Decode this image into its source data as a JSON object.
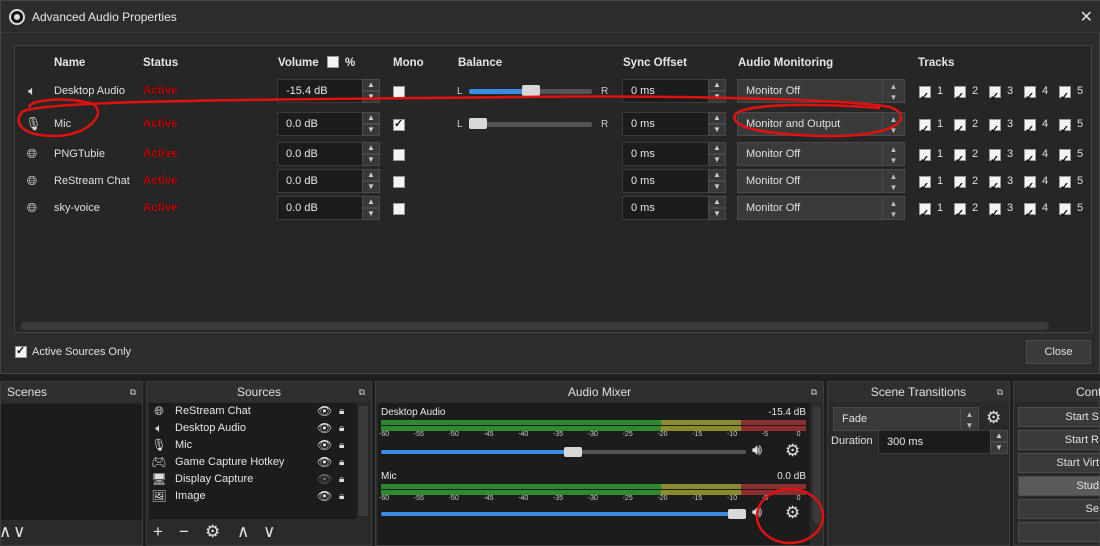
{
  "window": {
    "title": "Advanced Audio Properties",
    "close_glyph": "✕"
  },
  "columns": {
    "name": "Name",
    "status": "Status",
    "volume": "Volume",
    "percent": "%",
    "mono": "Mono",
    "balance": "Balance",
    "sync_offset": "Sync Offset",
    "audio_monitoring": "Audio Monitoring",
    "tracks": "Tracks"
  },
  "balance_labels": {
    "left": "L",
    "right": "R"
  },
  "rows": [
    {
      "icon": "speaker-icon",
      "name": "Desktop Audio",
      "status": "Active",
      "volume": "-15.4 dB",
      "mono": false,
      "balance": 0.5,
      "show_balance": true,
      "sync": "0 ms",
      "monitoring": "Monitor Off",
      "tracks": [
        true,
        true,
        true,
        true,
        true
      ]
    },
    {
      "icon": "microphone-icon",
      "name": "Mic",
      "status": "Active",
      "volume": "0.0 dB",
      "mono": true,
      "balance": 0.0,
      "show_balance": true,
      "sync": "0 ms",
      "monitoring": "Monitor and Output",
      "tracks": [
        true,
        true,
        true,
        true,
        true
      ]
    },
    {
      "icon": "globe-icon",
      "name": "PNGTubie",
      "status": "Active",
      "volume": "0.0 dB",
      "mono": false,
      "show_balance": false,
      "sync": "0 ms",
      "monitoring": "Monitor Off",
      "tracks": [
        true,
        true,
        true,
        true,
        true
      ]
    },
    {
      "icon": "globe-icon",
      "name": "ReStream Chat",
      "status": "Active",
      "volume": "0.0 dB",
      "mono": false,
      "show_balance": false,
      "sync": "0 ms",
      "monitoring": "Monitor Off",
      "tracks": [
        true,
        true,
        true,
        true,
        true
      ]
    },
    {
      "icon": "globe-icon",
      "name": "sky-voice",
      "status": "Active",
      "volume": "0.0 dB",
      "mono": false,
      "show_balance": false,
      "sync": "0 ms",
      "monitoring": "Monitor Off",
      "tracks": [
        true,
        true,
        true,
        true,
        true
      ]
    }
  ],
  "track_numbers": [
    "1",
    "2",
    "3",
    "4",
    "5"
  ],
  "footer": {
    "active_only_label": "Active Sources Only",
    "active_only_checked": true,
    "close_button": "Close"
  },
  "docks": {
    "scenes": {
      "title": "Scenes"
    },
    "sources": {
      "title": "Sources",
      "items": [
        {
          "icon": "globe-icon",
          "label": "ReStream Chat",
          "visible": true
        },
        {
          "icon": "speaker-icon",
          "label": "Desktop Audio",
          "visible": true
        },
        {
          "icon": "microphone-icon",
          "label": "Mic",
          "visible": true
        },
        {
          "icon": "gamepad-icon",
          "label": "Game Capture Hotkey",
          "visible": true
        },
        {
          "icon": "monitor-icon",
          "label": "Display Capture",
          "visible": false
        },
        {
          "icon": "image-icon",
          "label": "Image",
          "visible": true
        }
      ]
    },
    "mixer": {
      "title": "Audio Mixer",
      "scale_ticks": [
        "-60",
        "-55",
        "-50",
        "-45",
        "-40",
        "-35",
        "-30",
        "-25",
        "-20",
        "-15",
        "-10",
        "-5",
        "0"
      ],
      "channels": [
        {
          "name": "Desktop Audio",
          "db": "-15.4 dB",
          "volume_level": 0.55
        },
        {
          "name": "Mic",
          "db": "0.0 dB",
          "volume_level": 1.0
        }
      ]
    },
    "transitions": {
      "title": "Scene Transitions",
      "selected": "Fade",
      "duration_label": "Duration",
      "duration_value": "300 ms"
    },
    "controls": {
      "title": "Cont",
      "buttons": [
        "Start S",
        "Start R",
        "Start Virt",
        "Stud",
        "Se",
        ""
      ]
    }
  },
  "colors": {
    "accent": "#3b8ce6",
    "status_active": "#b00000",
    "annotation_red": "#e11111"
  }
}
